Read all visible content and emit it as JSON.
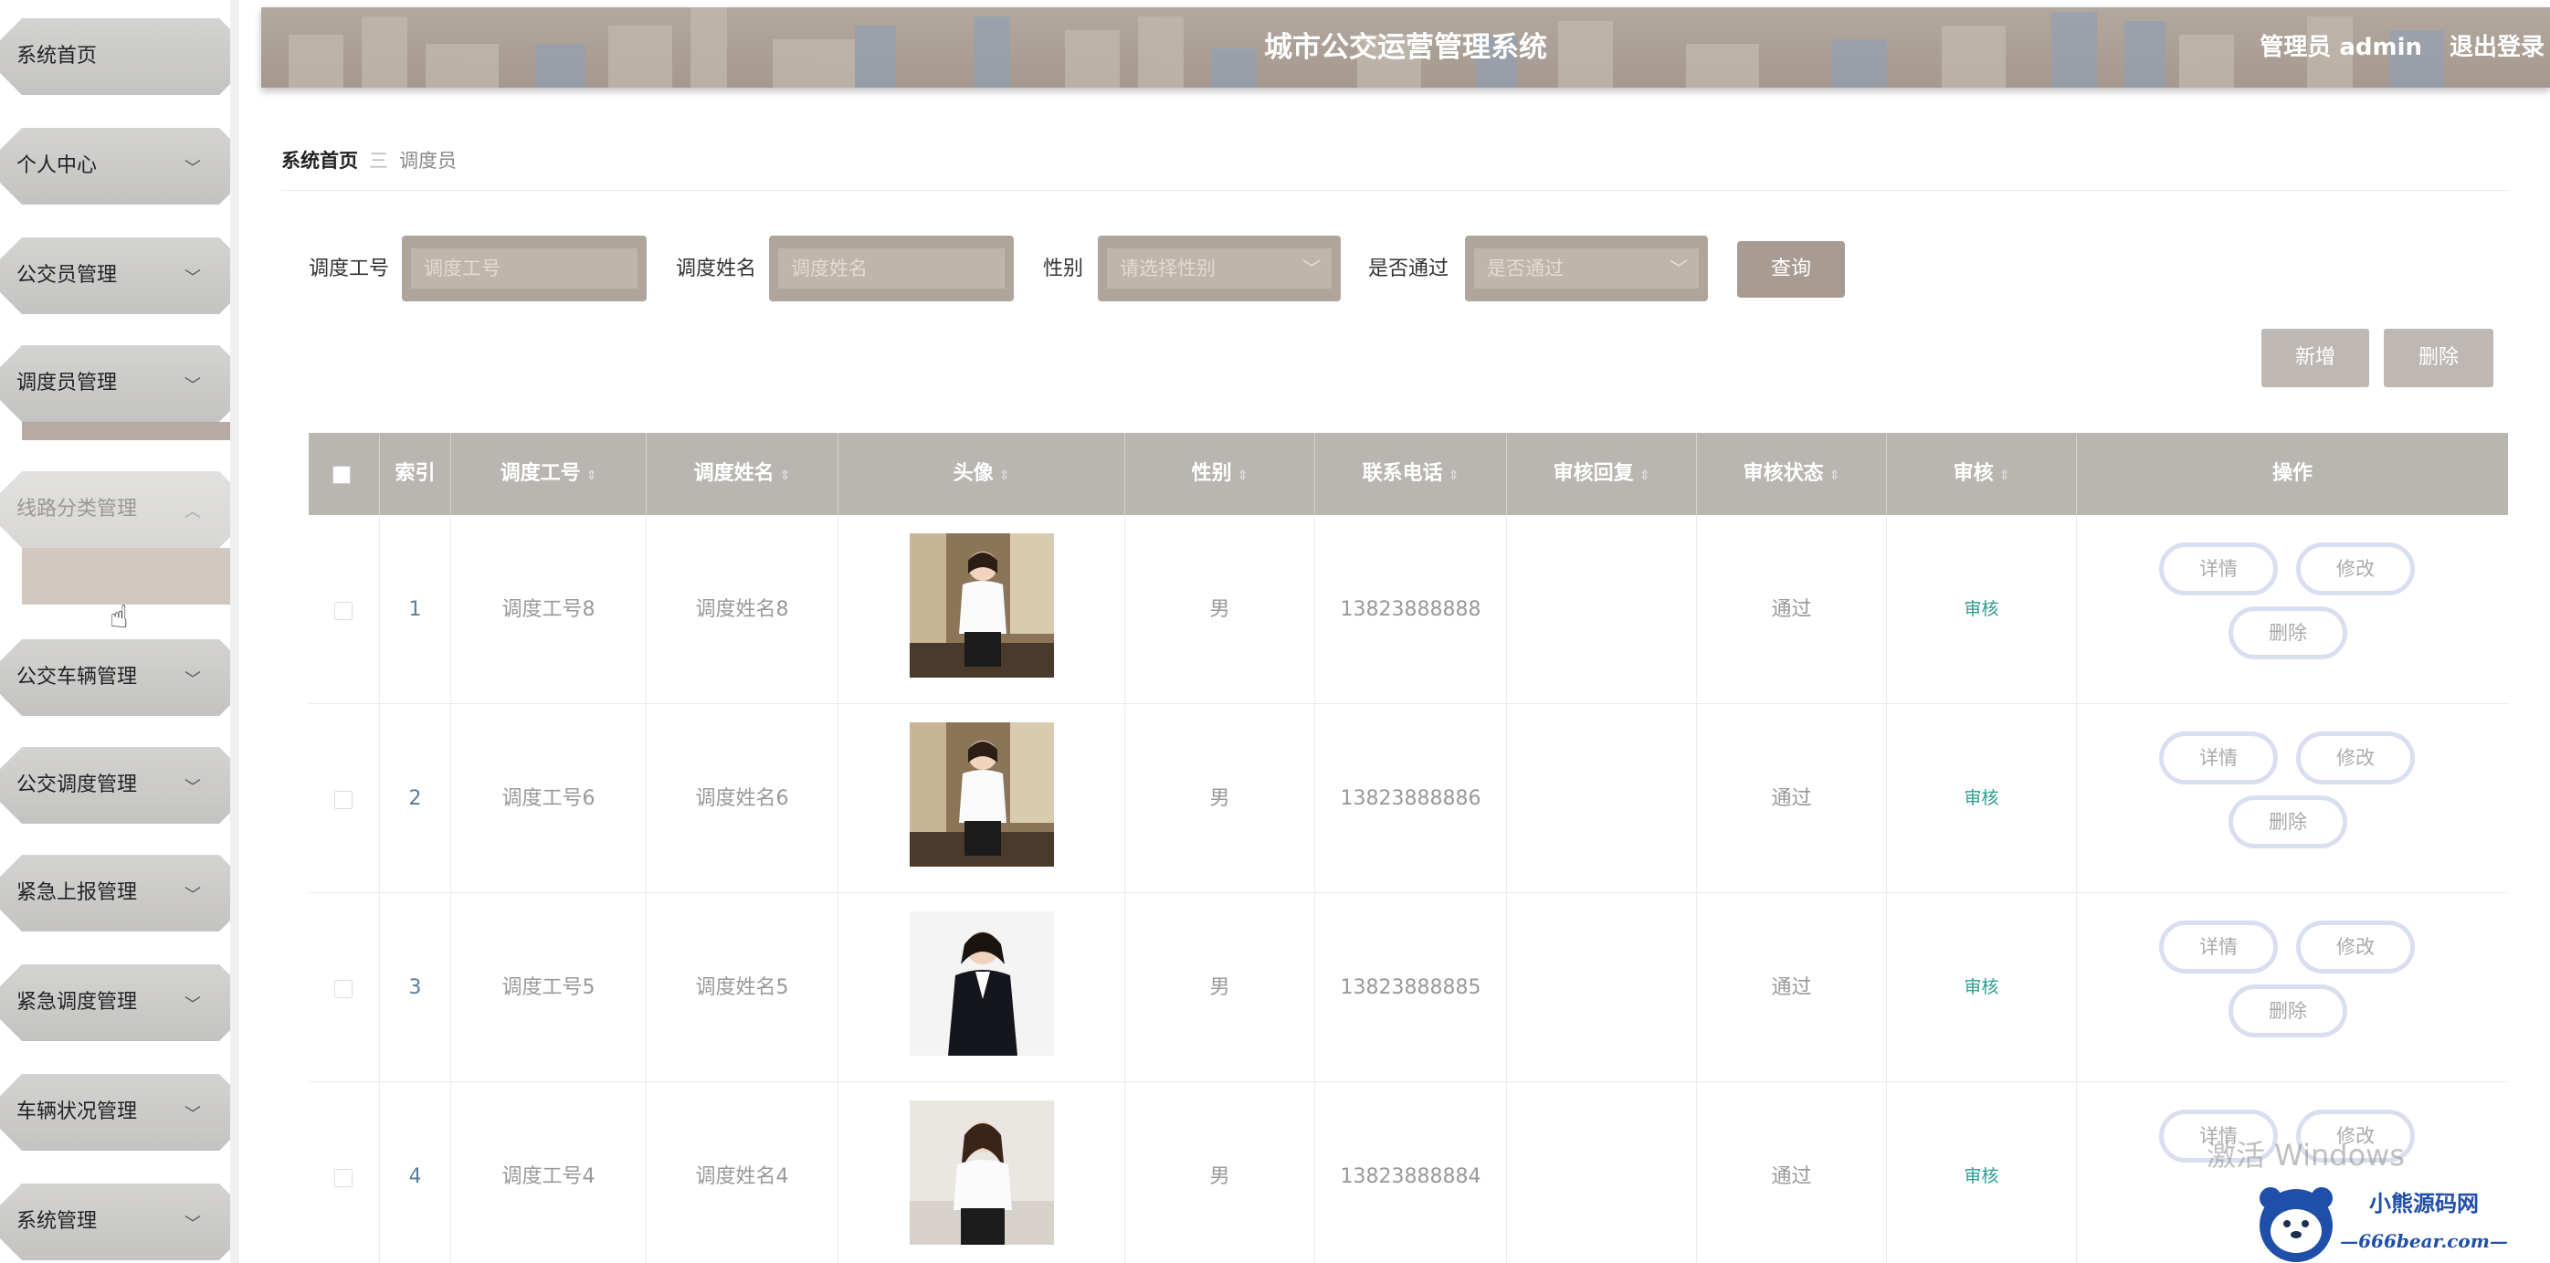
{
  "sidebar": {
    "items": [
      {
        "label": "系统首页"
      },
      {
        "label": "个人中心"
      },
      {
        "label": "公交员管理"
      },
      {
        "label": "调度员管理"
      },
      {
        "label": "线路分类管理"
      },
      {
        "label": "公交车辆管理"
      },
      {
        "label": "公交调度管理"
      },
      {
        "label": "紧急上报管理"
      },
      {
        "label": "紧急调度管理"
      },
      {
        "label": "车辆状况管理"
      },
      {
        "label": "系统管理"
      }
    ]
  },
  "header": {
    "title": "城市公交运营管理系统",
    "user": "管理员 admin",
    "logout": "退出登录"
  },
  "breadcrumb": {
    "home": "系统首页",
    "separator": "三",
    "current": "调度员"
  },
  "search": {
    "fields": [
      {
        "label": "调度工号",
        "placeholder": "调度工号"
      },
      {
        "label": "调度姓名",
        "placeholder": "调度姓名"
      },
      {
        "label": "性别",
        "placeholder": "请选择性别"
      },
      {
        "label": "是否通过",
        "placeholder": "是否通过"
      }
    ],
    "query_label": "查询"
  },
  "actions": {
    "add_label": "新增",
    "delete_label": "删除"
  },
  "table": {
    "columns": [
      "索引",
      "调度工号",
      "调度姓名",
      "头像",
      "性别",
      "联系电话",
      "审核回复",
      "审核状态",
      "审核",
      "操作"
    ],
    "rows": [
      {
        "index": "1",
        "id": "调度工号8",
        "name": "调度姓名8",
        "gender": "男",
        "phone": "13823888888",
        "reply": "",
        "status": "通过",
        "audit": "审核"
      },
      {
        "index": "2",
        "id": "调度工号6",
        "name": "调度姓名6",
        "gender": "男",
        "phone": "13823888886",
        "reply": "",
        "status": "通过",
        "audit": "审核"
      },
      {
        "index": "3",
        "id": "调度工号5",
        "name": "调度姓名5",
        "gender": "男",
        "phone": "13823888885",
        "reply": "",
        "status": "通过",
        "audit": "审核"
      },
      {
        "index": "4",
        "id": "调度工号4",
        "name": "调度姓名4",
        "gender": "男",
        "phone": "13823888884",
        "reply": "",
        "status": "通过",
        "audit": "审核"
      }
    ],
    "row_actions": {
      "detail": "详情",
      "edit": "修改",
      "delete": "删除"
    }
  },
  "watermark": "激活 Windows",
  "logo": {
    "line1": "小熊源码网",
    "line2": "—666bear.com—"
  },
  "colors": {
    "header": "#a99e94",
    "accent": "#a89b92",
    "audit_link": "#2a9d8f"
  }
}
